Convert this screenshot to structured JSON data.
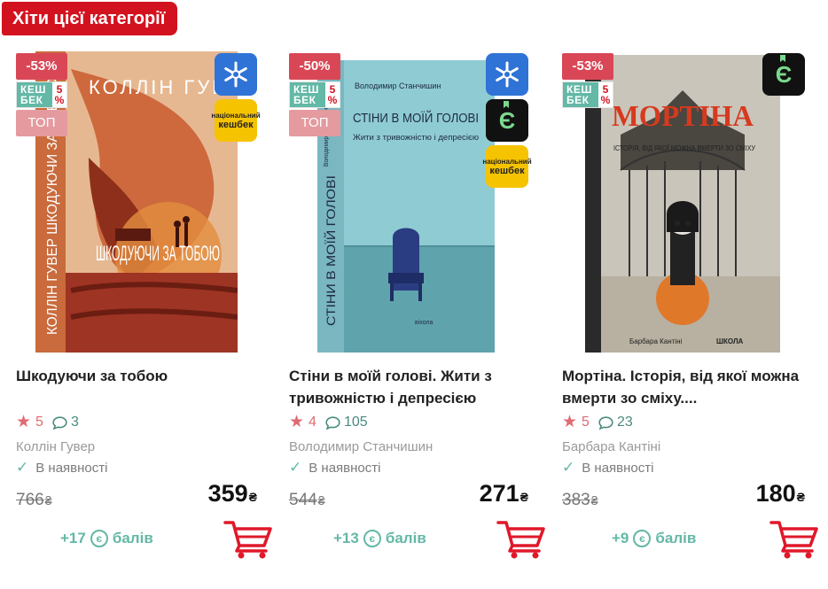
{
  "section": {
    "title": "Хіти цієї категорії"
  },
  "products": [
    {
      "discount": "-53%",
      "cashback_label": "КЕШ БЕК",
      "cashback_pct": "5 %",
      "top": "ТОП",
      "cover": {
        "author": "КОЛЛІН ГУВЕР",
        "title": "ШКОДУЮЧИ ЗА ТОБОЮ",
        "spine": "КОЛЛІН ГУВЕР ШКОДУЮЧИ ЗА ТОБОЮ"
      },
      "title": "Шкодуючи за тобою",
      "rating": "5",
      "comments": "3",
      "author": "Коллін Гувер",
      "availability": "В наявності",
      "old_price": "766",
      "price": "359",
      "currency": "₴",
      "bonus_prefix": "+17",
      "bonus_suffix": "балів"
    },
    {
      "discount": "-50%",
      "cashback_label": "КЕШ БЕК",
      "cashback_pct": "5 %",
      "top": "ТОП",
      "cover": {
        "author": "Володимир Станчишин",
        "title": "СТІНИ В МОЇЙ ГОЛОВІ",
        "subtitle": "Жити з тривожністю і депресією",
        "spine": "СТІНИ В МОЇЙ ГОЛОВІ",
        "spine_author": "Володимир Станчишин",
        "publisher": "віхола"
      },
      "title": "Стіни в моїй голові. Жити з тривожністю і депресією",
      "rating": "4",
      "comments": "105",
      "author": "Володимир Станчишин",
      "availability": "В наявності",
      "old_price": "544",
      "price": "271",
      "currency": "₴",
      "bonus_prefix": "+13",
      "bonus_suffix": "балів"
    },
    {
      "discount": "-53%",
      "cashback_label": "КЕШ БЕК",
      "cashback_pct": "5 %",
      "cover": {
        "title": "МОРТІНА",
        "subtitle": "ІСТОРІЯ, ВІД ЯКОЇ МОЖНА ВМЕРТИ ЗО СМІХУ",
        "author": "Барбара Кантіні",
        "publisher": "ШКОЛА"
      },
      "title": "Мортіна. Історія, від якої можна вмерти зо сміху....",
      "rating": "5",
      "comments": "23",
      "author": "Барбара Кантіні",
      "availability": "В наявності",
      "old_price": "383",
      "price": "180",
      "currency": "₴",
      "bonus_prefix": "+9",
      "bonus_suffix": "балів"
    }
  ],
  "pay_badges": {
    "monobank_symbol": "Є",
    "nk_line1": "національний",
    "nk_line2": "кешбек"
  },
  "bonus_coin_symbol": "є",
  "icons": {
    "rating": "star-icon",
    "comments": "comment-icon",
    "availability": "check-icon",
    "cart": "cart-icon",
    "snowflake": "snowflake-icon"
  },
  "colors": {
    "accent_red": "#d3121f",
    "discount": "#d94756",
    "teal": "#63b8a6",
    "star": "#e06b74",
    "top": "#e49a9f"
  }
}
